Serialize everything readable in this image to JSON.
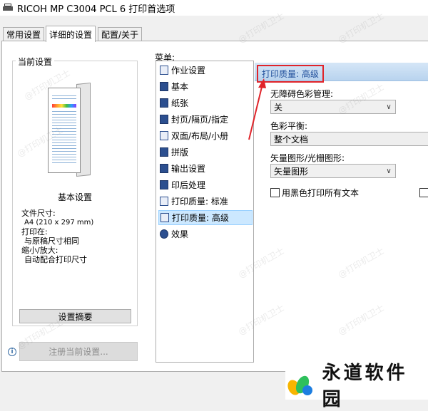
{
  "window": {
    "title": "RICOH MP C3004 PCL 6 打印首选项"
  },
  "tabs": [
    {
      "label": "常用设置"
    },
    {
      "label": "详细的设置"
    },
    {
      "label": "配置/关于"
    }
  ],
  "current_settings": {
    "group_title": "当前设置",
    "summary_label": "基本设置",
    "paper_size_label": "文件尺寸:",
    "paper_size_value": "A4 (210 x 297 mm)",
    "print_on_label": "打印在:",
    "print_on_value": "与原稿尺寸相同",
    "scale_label": "缩小/放大:",
    "scale_value": "自动配合打印尺寸",
    "summary_button": "设置摘要",
    "register_button": "注册当前设置..."
  },
  "menu": {
    "label": "菜单:",
    "items": [
      {
        "label": "作业设置"
      },
      {
        "label": "基本"
      },
      {
        "label": "纸张"
      },
      {
        "label": "封页/隔页/指定"
      },
      {
        "label": "双面/布局/小册"
      },
      {
        "label": "拼版"
      },
      {
        "label": "输出设置"
      },
      {
        "label": "印后处理"
      },
      {
        "label": "打印质量: 标准"
      },
      {
        "label": "打印质量: 高级"
      },
      {
        "label": "效果"
      }
    ],
    "selected_index": 9
  },
  "panel": {
    "title": "打印质量: 高级",
    "color_management_label": "无障碍色彩管理:",
    "color_management_value": "关",
    "color_balance_label": "色彩平衡:",
    "color_balance_value": "整个文档",
    "vector_raster_label": "矢量图形/光栅图形:",
    "vector_raster_value": "矢量图形",
    "black_text_label": "用黑色打印所有文本"
  },
  "watermark": "@打印机卫士",
  "brand": {
    "text": "永道软件园"
  },
  "colors": {
    "highlight_red": "#e0242a",
    "selection": "#cce8ff",
    "header": "#b8d3ee"
  }
}
